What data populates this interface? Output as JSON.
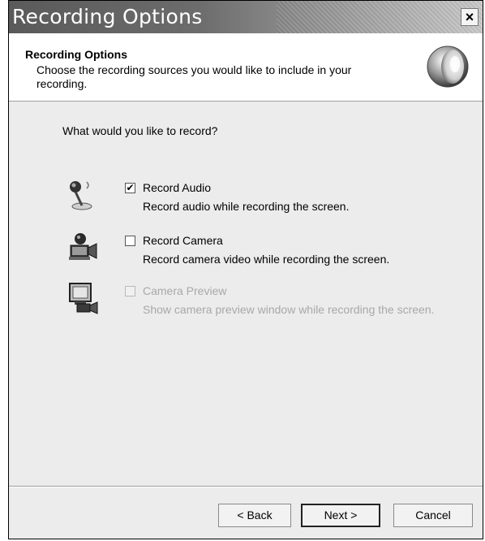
{
  "window": {
    "title": "Recording Options",
    "close_label": "×"
  },
  "header": {
    "title": "Recording Options",
    "description": "Choose the recording sources you would like to include in your recording."
  },
  "main": {
    "question": "What would you like to record?",
    "options": [
      {
        "label": "Record Audio",
        "description": "Record audio while recording the screen.",
        "checked": true,
        "enabled": true,
        "icon": "microphone-icon"
      },
      {
        "label": "Record Camera",
        "description": "Record camera video while recording the screen.",
        "checked": false,
        "enabled": true,
        "icon": "camera-icon"
      },
      {
        "label": "Camera Preview",
        "description": "Show camera preview window while recording the screen.",
        "checked": false,
        "enabled": false,
        "icon": "camera-preview-icon"
      }
    ]
  },
  "footer": {
    "back_label": "< Back",
    "next_label": "Next >",
    "cancel_label": "Cancel"
  },
  "check_mark": "✔"
}
